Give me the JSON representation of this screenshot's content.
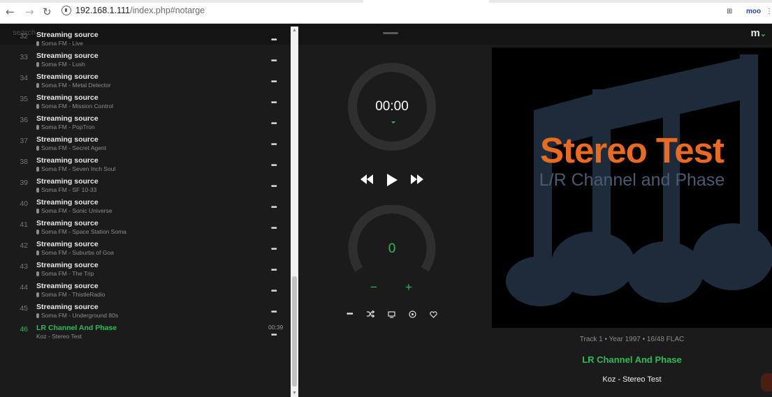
{
  "browser": {
    "url_host": "192.168.1.111",
    "url_path": "/index.php#notarge",
    "ext_label": "moo"
  },
  "app": {
    "search_placeholder": "search",
    "logo": "m"
  },
  "playlist": [
    {
      "num": "32",
      "title": "Streaming source",
      "sub": "Soma FM - Live"
    },
    {
      "num": "33",
      "title": "Streaming source",
      "sub": "Soma FM - Lush"
    },
    {
      "num": "34",
      "title": "Streaming source",
      "sub": "Soma FM - Metal Detector"
    },
    {
      "num": "35",
      "title": "Streaming source",
      "sub": "Soma FM - Mission Control"
    },
    {
      "num": "36",
      "title": "Streaming source",
      "sub": "Soma FM - PopTron"
    },
    {
      "num": "37",
      "title": "Streaming source",
      "sub": "Soma FM - Secret Agent"
    },
    {
      "num": "38",
      "title": "Streaming source",
      "sub": "Soma FM - Seven Inch Soul"
    },
    {
      "num": "39",
      "title": "Streaming source",
      "sub": "Soma FM - SF 10-33"
    },
    {
      "num": "40",
      "title": "Streaming source",
      "sub": "Soma FM - Sonic Universe"
    },
    {
      "num": "41",
      "title": "Streaming source",
      "sub": "Soma FM - Space Station Soma"
    },
    {
      "num": "42",
      "title": "Streaming source",
      "sub": "Soma FM - Suburbs of Goa"
    },
    {
      "num": "43",
      "title": "Streaming source",
      "sub": "Soma FM - The Trip"
    },
    {
      "num": "44",
      "title": "Streaming source",
      "sub": "Soma FM - ThistleRadio"
    },
    {
      "num": "45",
      "title": "Streaming source",
      "sub": "Soma FM - Underground 80s"
    },
    {
      "num": "46",
      "title": "LR Channel And Phase",
      "sub": "Koz - Stereo Test",
      "duration": "00:39",
      "active": true
    }
  ],
  "player": {
    "time": "00:00",
    "volume": "0",
    "vol_down": "−",
    "vol_up": "+"
  },
  "cover": {
    "title": "Stereo Test",
    "subtitle": "L/R Channel and Phase"
  },
  "now_playing": {
    "meta": "Track 1 • Year 1997 • 16/48 FLAC",
    "title": "LR Channel And Phase",
    "artist": "Koz - Stereo Test"
  }
}
